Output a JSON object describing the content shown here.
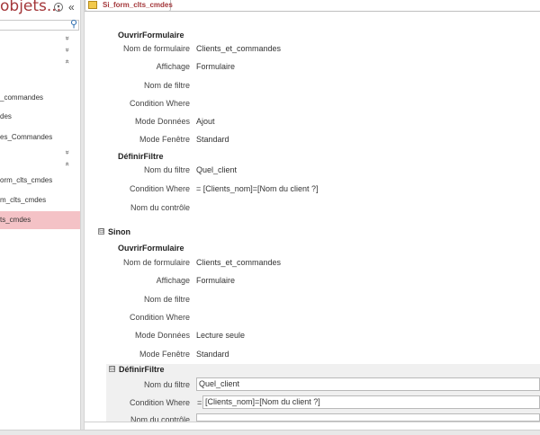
{
  "nav": {
    "title": "objets...",
    "dropdown_glyph": "▾",
    "collapse_glyph": "«",
    "search_icon": "⚲",
    "chevrons": [
      "»",
      "»",
      "«",
      "»",
      "«"
    ],
    "items": [
      {
        "label": "_commandes",
        "selected": false
      },
      {
        "label": "des",
        "selected": false
      },
      {
        "label": "es_Commandes",
        "selected": false
      },
      {
        "label": "orm_clts_cmdes",
        "selected": false
      },
      {
        "label": "m_clts_cmdes",
        "selected": false
      },
      {
        "label": "ts_cmdes",
        "selected": true
      }
    ]
  },
  "tab": {
    "label": "Si_form_clts_cmdes"
  },
  "macro": {
    "block1": {
      "header": "OuvrirFormulaire",
      "rows": [
        {
          "label": "Nom de formulaire",
          "value": "Clients_et_commandes"
        },
        {
          "label": "Affichage",
          "value": "Formulaire"
        },
        {
          "label": "Nom de filtre",
          "value": ""
        },
        {
          "label": "Condition Where",
          "value": ""
        },
        {
          "label": "Mode Données",
          "value": "Ajout"
        },
        {
          "label": "Mode Fenêtre",
          "value": "Standard"
        }
      ]
    },
    "block2": {
      "header": "DéfinirFiltre",
      "rows": [
        {
          "label": "Nom du filtre",
          "value": "Quel_client"
        },
        {
          "label": "Condition Where",
          "value": "= [Clients_nom]=[Nom du client ?]"
        },
        {
          "label": "Nom du contrôle",
          "value": ""
        }
      ]
    },
    "else_label": "Sinon",
    "else_toggle": "⊟",
    "block3": {
      "header": "OuvrirFormulaire",
      "rows": [
        {
          "label": "Nom de formulaire",
          "value": "Clients_et_commandes"
        },
        {
          "label": "Affichage",
          "value": "Formulaire"
        },
        {
          "label": "Nom de filtre",
          "value": ""
        },
        {
          "label": "Condition Where",
          "value": ""
        },
        {
          "label": "Mode Données",
          "value": "Lecture seule"
        },
        {
          "label": "Mode Fenêtre",
          "value": "Standard"
        }
      ]
    },
    "block4": {
      "header": "DéfinirFiltre",
      "toggle": "⊟",
      "rows": [
        {
          "label": "Nom du filtre",
          "value": "Quel_client",
          "eq": ""
        },
        {
          "label": "Condition Where",
          "value": "[Clients_nom]=[Nom du client ?]",
          "eq": "="
        },
        {
          "label": "Nom du contrôle",
          "value": "",
          "eq": ""
        }
      ]
    }
  }
}
